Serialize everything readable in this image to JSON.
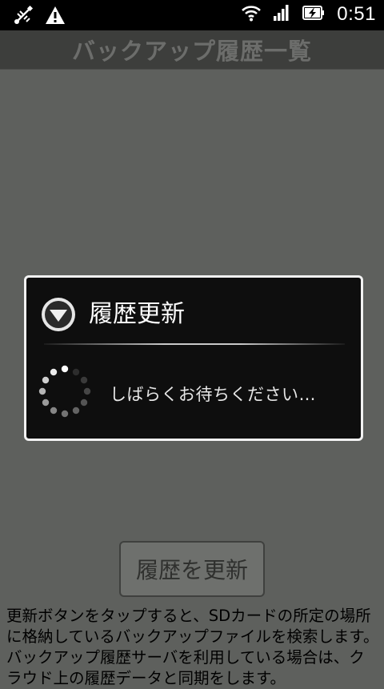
{
  "status_bar": {
    "time": "0:51",
    "icons": [
      "usb-debug-icon",
      "warning-icon",
      "wifi-icon",
      "signal-icon",
      "battery-charging-icon"
    ]
  },
  "title_bar": {
    "title": "バックアップ履歴一覧"
  },
  "dialog": {
    "title": "履歴更新",
    "message": "しばらくお待ちください…",
    "icon": "dropdown-circle-icon"
  },
  "refresh_button": {
    "label": "履歴を更新"
  },
  "description": "更新ボタンをタップすると、SDカードの所定の場所に格納しているバックアップファイルを検索します。バックアップ履歴サーバを利用している場合は、クラウド上の履歴データと同期をします。",
  "colors": {
    "background": "#5e605d",
    "title_bar": "#3d3e3c",
    "dialog_bg": "#0e0e0e",
    "dialog_border": "#f2f2f2"
  }
}
